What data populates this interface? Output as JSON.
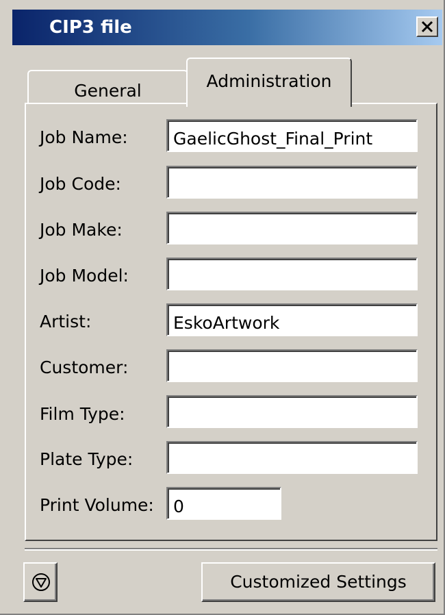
{
  "window": {
    "title": "CIP3 file",
    "close_icon": "close-icon"
  },
  "tabs": [
    {
      "label": "General",
      "active": false
    },
    {
      "label": "Administration",
      "active": true
    }
  ],
  "fields": {
    "job_name": {
      "label": "Job Name:",
      "value": "GaelicGhost_Final_Print"
    },
    "job_code": {
      "label": "Job Code:",
      "value": ""
    },
    "job_make": {
      "label": "Job Make:",
      "value": ""
    },
    "job_model": {
      "label": "Job Model:",
      "value": ""
    },
    "artist": {
      "label": "Artist:",
      "value": "EskoArtwork"
    },
    "customer": {
      "label": "Customer:",
      "value": ""
    },
    "film_type": {
      "label": "Film Type:",
      "value": ""
    },
    "plate_type": {
      "label": "Plate Type:",
      "value": ""
    },
    "print_volume": {
      "label": "Print Volume:",
      "value": "0"
    }
  },
  "footer": {
    "icon_button_icon": "shield-triangle-icon",
    "customized_settings_label": "Customized Settings"
  },
  "colors": {
    "titlebar_start": "#0a246a",
    "titlebar_end": "#a6caf0",
    "face": "#d4d0c8"
  }
}
